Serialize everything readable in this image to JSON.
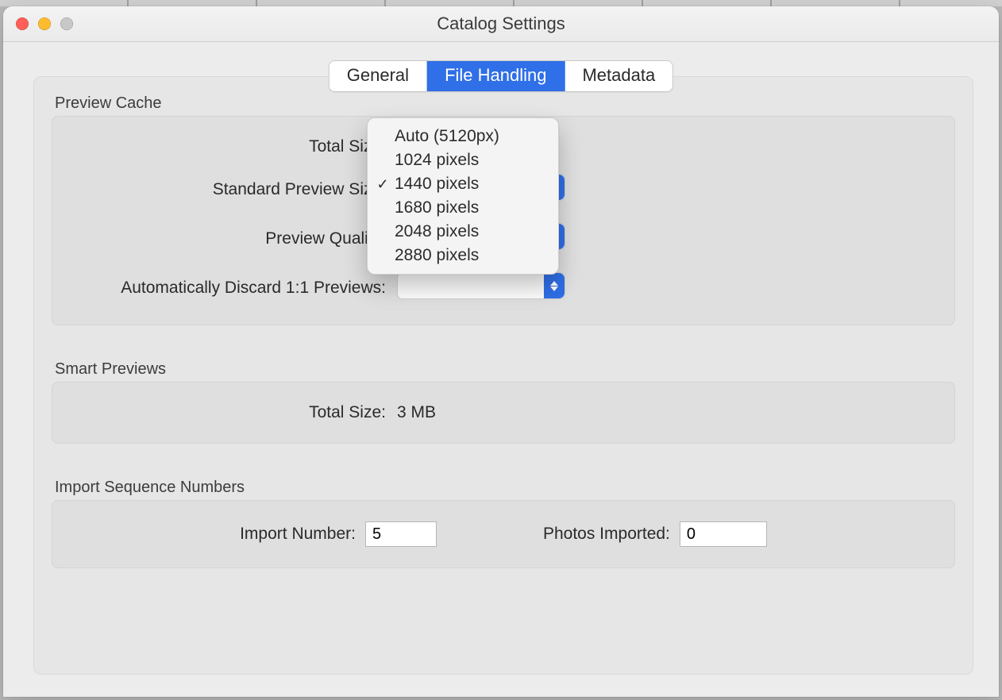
{
  "window": {
    "title": "Catalog Settings"
  },
  "tabs": {
    "items": [
      "General",
      "File Handling",
      "Metadata"
    ],
    "active_index": 1
  },
  "sections": {
    "preview_cache": {
      "title": "Preview Cache",
      "total_size_label": "Total Size:",
      "standard_preview_size_label": "Standard Preview Size:",
      "preview_quality_label": "Preview Quality:",
      "discard_label": "Automatically Discard 1:1 Previews:"
    },
    "smart_previews": {
      "title": "Smart Previews",
      "total_size_label": "Total Size:",
      "total_size_value": "3 MB"
    },
    "import_sequence": {
      "title": "Import Sequence Numbers",
      "import_number_label": "Import Number:",
      "import_number_value": "5",
      "photos_imported_label": "Photos Imported:",
      "photos_imported_value": "0"
    }
  },
  "dropdown": {
    "options": [
      "Auto (5120px)",
      "1024 pixels",
      "1440 pixels",
      "1680 pixels",
      "2048 pixels",
      "2880 pixels"
    ],
    "selected_index": 2
  }
}
